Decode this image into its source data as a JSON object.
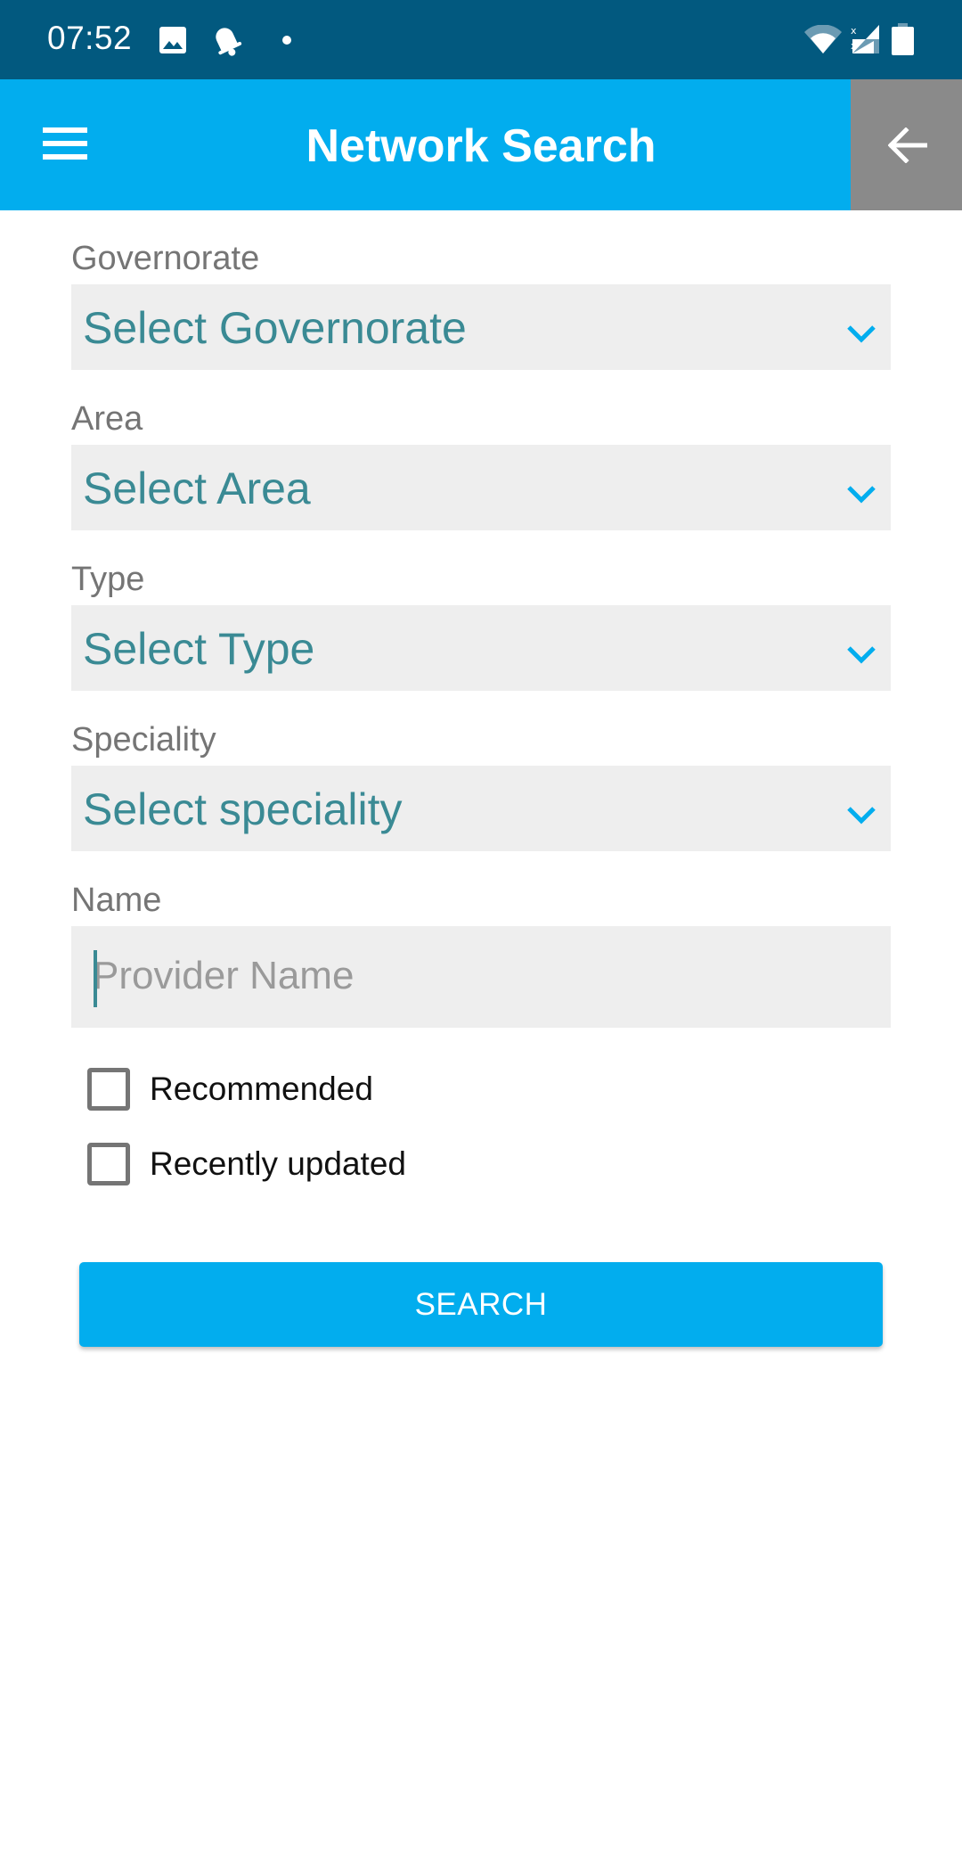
{
  "status_bar": {
    "time": "07:52",
    "notification_icons": [
      "image-icon",
      "bell-icon",
      "dot-icon"
    ],
    "system_icons": [
      "wifi-icon",
      "signal-no-sim-icon",
      "battery-icon"
    ]
  },
  "app_bar": {
    "title": "Network Search",
    "menu_icon": "hamburger-menu-icon",
    "back_icon": "arrow-left-icon"
  },
  "form": {
    "governorate": {
      "label": "Governorate",
      "value": "Select Governorate"
    },
    "area": {
      "label": "Area",
      "value": "Select Area"
    },
    "type": {
      "label": "Type",
      "value": "Select Type"
    },
    "speciality": {
      "label": "Speciality",
      "value": "Select speciality"
    },
    "name": {
      "label": "Name",
      "value": "",
      "placeholder": "Provider Name"
    },
    "checkboxes": [
      {
        "label": "Recommended",
        "checked": false
      },
      {
        "label": "Recently updated",
        "checked": false
      }
    ],
    "search_label": "SEARCH"
  },
  "colors": {
    "status_bar": "#02597f",
    "app_bar": "#02adee",
    "back_button": "#8a8a8a",
    "dropdown_text": "#3a8a94",
    "chevron": "#02adee",
    "field_bg": "#eeeeee"
  }
}
